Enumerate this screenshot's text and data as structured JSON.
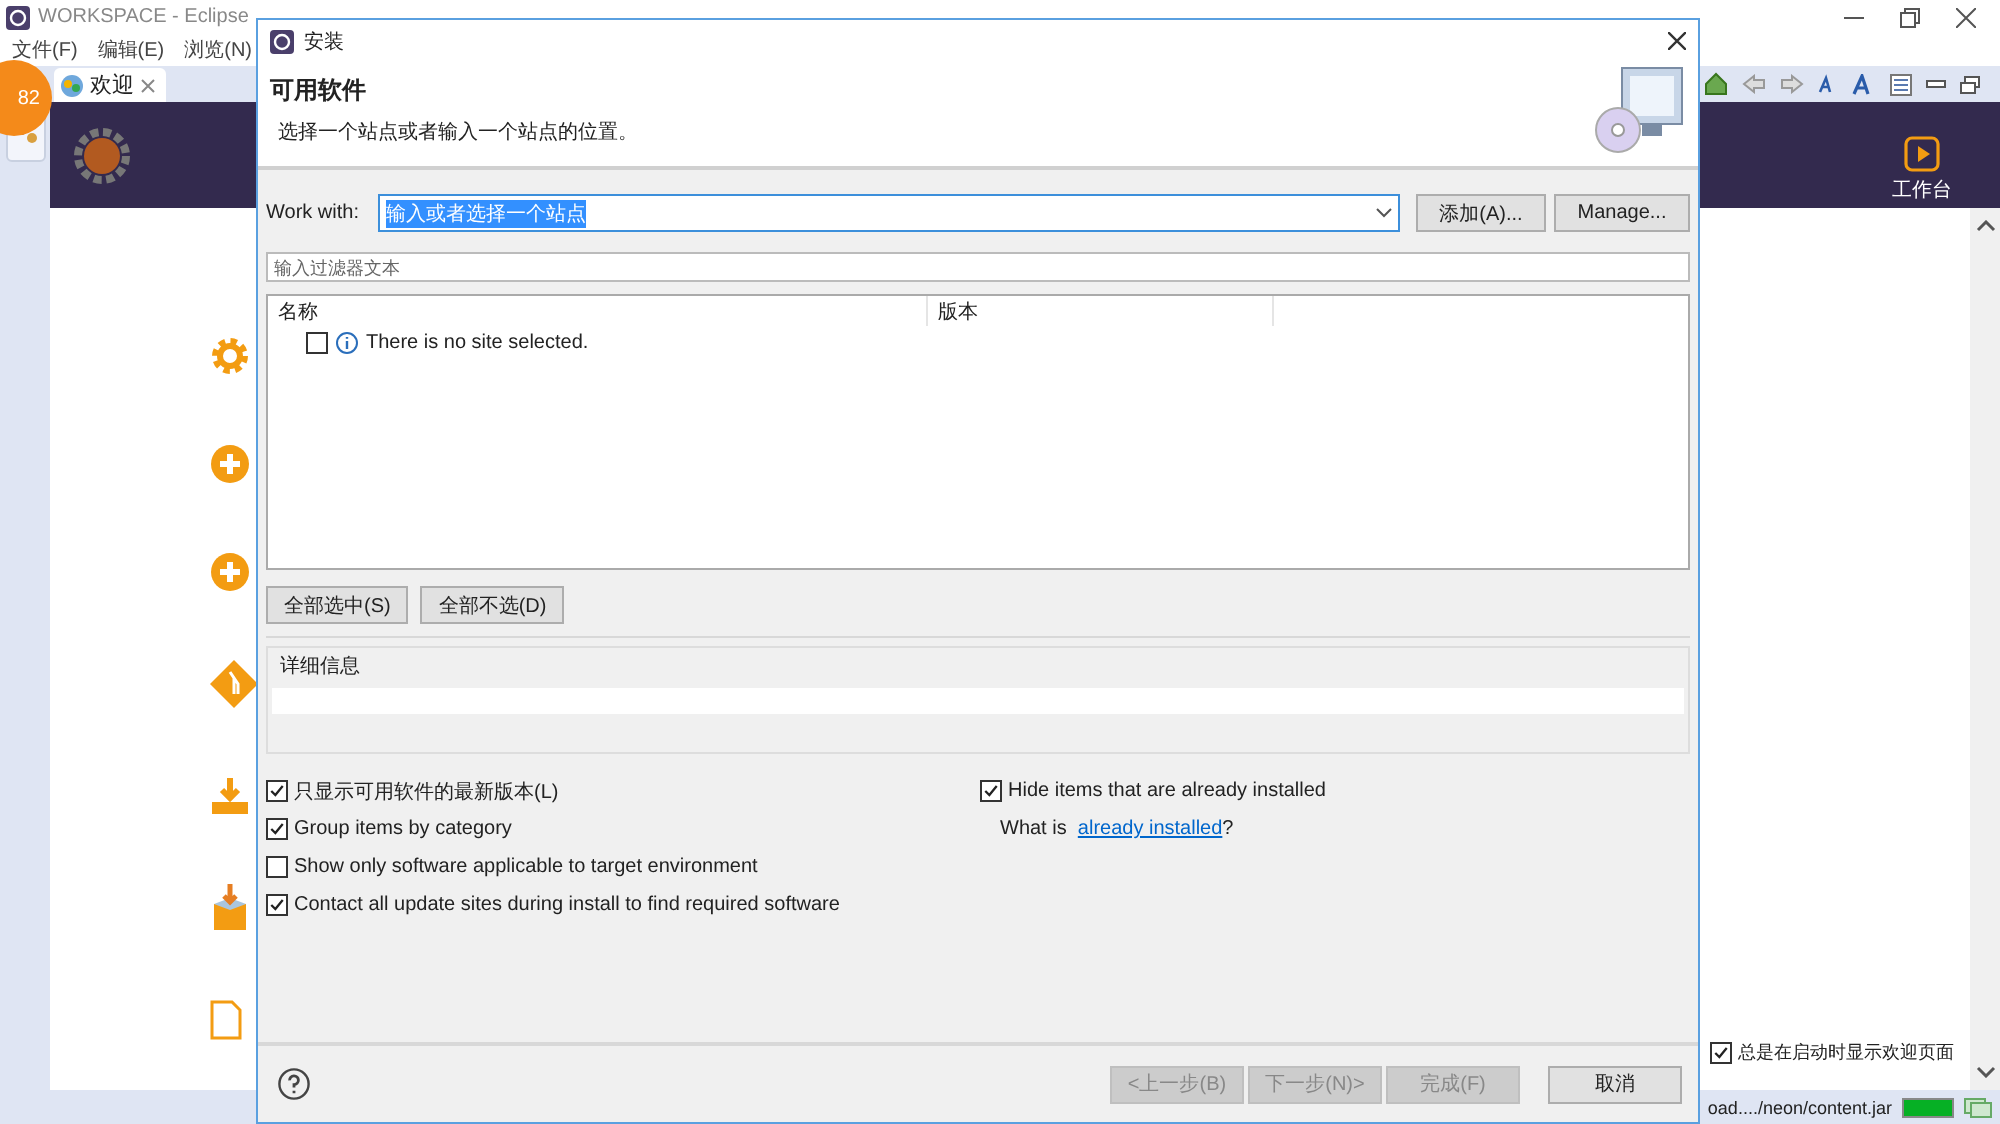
{
  "eclipse": {
    "title": "WORKSPACE - Eclipse",
    "menus": [
      "文件(F)",
      "编辑(E)",
      "浏览(N)"
    ],
    "badge": "82",
    "tab": {
      "label": "欢迎"
    },
    "workbench": "工作台",
    "show_on_startup": {
      "label": "总是在启动时显示欢迎页面",
      "checked": true
    },
    "status": "oad..../neon/content.jar",
    "progress": {
      "level": 1
    }
  },
  "dialog": {
    "title": "安装",
    "heading": "可用软件",
    "description": "选择一个站点或者输入一个站点的位置。",
    "work_with": {
      "label": "Work with:",
      "value": "输入或者选择一个站点"
    },
    "buttons_top": [
      "添加(A)...",
      "Manage..."
    ],
    "filter": {
      "placeholder": "输入过滤器文本"
    },
    "columns": [
      "名称",
      "版本"
    ],
    "rows": [
      {
        "text": "There is no site selected.",
        "checked": false
      }
    ],
    "select_buttons": [
      "全部选中(S)",
      "全部不选(D)"
    ],
    "details": {
      "label": "详细信息"
    },
    "options_left": [
      {
        "label": "只显示可用软件的最新版本(L)",
        "checked": true
      },
      {
        "label": "Group items by category",
        "checked": true
      },
      {
        "label": "Show only software applicable to target environment",
        "checked": false
      },
      {
        "label": "Contact all update sites during install to find required software",
        "checked": true
      }
    ],
    "options_right": [
      {
        "label": "Hide items that are already installed",
        "checked": true
      }
    ],
    "what_is": {
      "before": "What is ",
      "link": "already installed",
      "after": "?"
    },
    "footer_buttons": [
      {
        "label": "<上一步(B)",
        "disabled": true
      },
      {
        "label": "下一步(N)>",
        "disabled": true
      },
      {
        "label": "完成(F)",
        "disabled": true
      },
      {
        "label": "取消",
        "disabled": false
      }
    ]
  }
}
